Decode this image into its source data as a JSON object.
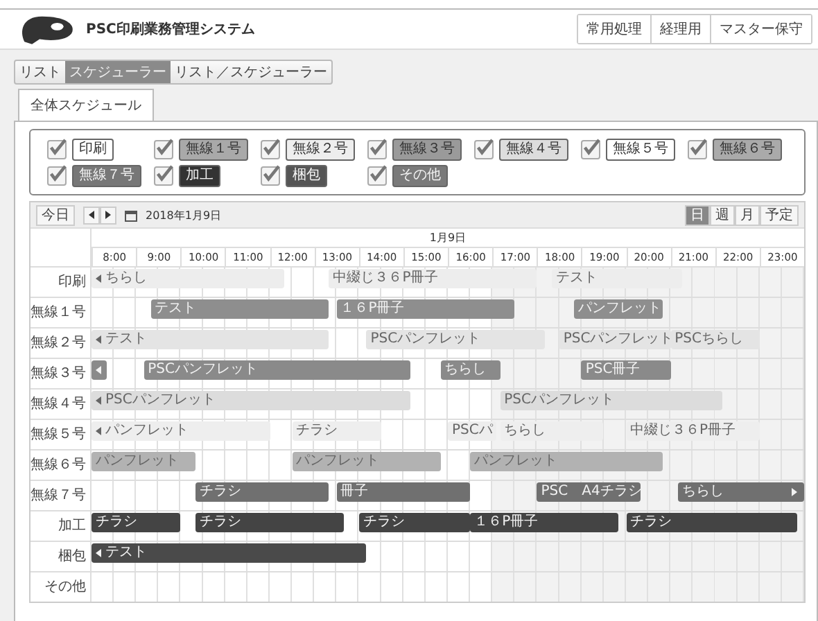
{
  "header": {
    "title": "PSC印刷業務管理システム",
    "menu": [
      "常用処理",
      "経理用",
      "マスター保守"
    ]
  },
  "view_tabs": [
    {
      "label": "リスト",
      "selected": false
    },
    {
      "label": "スケジューラー",
      "selected": true
    },
    {
      "label": "リスト／スケジューラー",
      "selected": false
    }
  ],
  "sub_tabs": [
    {
      "label": "全体スケジュール",
      "selected": true
    }
  ],
  "filters": [
    {
      "label": "印刷",
      "checked": true,
      "color": "#ffffff"
    },
    {
      "label": "無線１号",
      "checked": true,
      "color": "#a9a9a9"
    },
    {
      "label": "無線２号",
      "checked": true,
      "color": "#eeeeee"
    },
    {
      "label": "無線３号",
      "checked": true,
      "color": "#9a9a9a"
    },
    {
      "label": "無線４号",
      "checked": true,
      "color": "#dddddd"
    },
    {
      "label": "無線５号",
      "checked": true,
      "color": "#ffffff"
    },
    {
      "label": "無線６号",
      "checked": true,
      "color": "#aaaaaa"
    },
    {
      "label": "無線７号",
      "checked": true,
      "color": "#777777"
    },
    {
      "label": "加工",
      "checked": true,
      "color": "#333333"
    },
    {
      "label": "梱包",
      "checked": true,
      "color": "#555555"
    },
    {
      "label": "その他",
      "checked": true,
      "color": "#7a7a7a"
    }
  ],
  "toolbar": {
    "today": "今日",
    "date": "2018年1月9日",
    "views": [
      {
        "label": "日",
        "selected": true
      },
      {
        "label": "週",
        "selected": false
      },
      {
        "label": "月",
        "selected": false
      },
      {
        "label": "予定",
        "selected": false
      }
    ]
  },
  "schedule": {
    "day": "1月9日",
    "hours": [
      "8:00",
      "9:00",
      "10:00",
      "11:00",
      "12:00",
      "13:00",
      "14:00",
      "15:00",
      "16:00",
      "17:00",
      "18:00",
      "19:00",
      "20:00",
      "21:00",
      "22:00",
      "23:00"
    ],
    "resources": [
      {
        "name": "印刷",
        "color": "#ededed",
        "events": [
          {
            "title": "ちらし",
            "continues_before": true
          },
          {
            "title": "中綴じ３６P冊子"
          },
          {
            "title": "テスト"
          }
        ]
      },
      {
        "name": "無線１号",
        "color": "#8e8e8e",
        "events": [
          {
            "title": "テスト"
          },
          {
            "title": "１６P冊子"
          },
          {
            "title": "パンフレット"
          }
        ]
      },
      {
        "name": "無線２号",
        "color": "#e4e4e4",
        "events": [
          {
            "title": "テスト",
            "continues_before": true
          },
          {
            "title": "PSCパンフレット"
          },
          {
            "title": "PSCパンフレット"
          },
          {
            "title": "PSCちらし"
          }
        ]
      },
      {
        "name": "無線３号",
        "color": "#8a8a8a",
        "events": [
          {
            "continues_before": true
          },
          {
            "title": "PSCパンフレット"
          },
          {
            "title": "ちらし"
          },
          {
            "title": "PSC冊子"
          }
        ]
      },
      {
        "name": "無線４号",
        "color": "#dcdcdc",
        "events": [
          {
            "title": "PSCパンフレット",
            "continues_before": true
          },
          {
            "title": "PSCパンフレット"
          }
        ]
      },
      {
        "name": "無線５号",
        "color": "#eeeeee",
        "events": [
          {
            "title": "パンフレット",
            "continues_before": true
          },
          {
            "title": "チラシ"
          },
          {
            "title": "PSCパ"
          },
          {
            "title": "ちらし"
          },
          {
            "title": "中綴じ３６P冊子"
          }
        ]
      },
      {
        "name": "無線６号",
        "color": "#b2b2b2",
        "events": [
          {
            "title": "パンフレット"
          },
          {
            "title": "パンフレット"
          },
          {
            "title": "パンフレット"
          }
        ]
      },
      {
        "name": "無線７号",
        "color": "#707070",
        "events": [
          {
            "title": "チラシ"
          },
          {
            "title": "冊子"
          },
          {
            "title": "PSC　A4チラシ"
          },
          {
            "title": "ちらし",
            "continues_after": true
          }
        ]
      },
      {
        "name": "加工",
        "color": "#444444",
        "events": [
          {
            "title": "チラシ"
          },
          {
            "title": "チラシ"
          },
          {
            "title": "チラシ"
          },
          {
            "title": "１６P冊子"
          },
          {
            "title": "チラシ"
          }
        ]
      },
      {
        "name": "梱包",
        "color": "#4a4a4a",
        "events": [
          {
            "title": "テスト",
            "continues_before": true
          }
        ]
      },
      {
        "name": "その他"
      }
    ]
  }
}
